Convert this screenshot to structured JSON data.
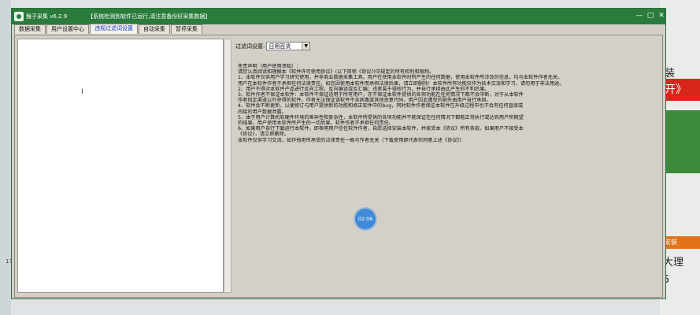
{
  "background": {
    "left_number": "17",
    "ad_text_1": "装",
    "ad_red": "开》",
    "ad_orange": "安装",
    "ad_text_2": "大理",
    "ad_text_3": "5"
  },
  "window": {
    "title": "猴子采集 v6.2.9",
    "notice": "【系统检测到软件已运行,请注意备份好采集数据】",
    "controls": {
      "minimize": "—",
      "maximize": "□",
      "close": "✕"
    }
  },
  "tabs": [
    {
      "label": "数据采集",
      "active": false
    },
    {
      "label": "用户设置中心",
      "active": false
    },
    {
      "label": "违规过滤词设置",
      "active": true
    },
    {
      "label": "自动采集",
      "active": false
    },
    {
      "label": "暂停采集",
      "active": false
    }
  ],
  "filter": {
    "label": "过滤词设置:",
    "selected": "日用百货"
  },
  "disclaimer": [
    "免责声明（用户使用须知）:",
    "请您认真阅读和理解本《软件许可使用协议》(以下简称《协议》)中规定的所有权利和限制。",
    "1、本软件仅供用户学习研究使用，并非商业数据采集工具。用户在使用本软件时所产生的任何数据，使用本软件所涉及的信息，均与本软件作者无关。",
    "用户在本软件作者不承担任何法律责任，如您因使用本软件而承担法律后果，请立即删除！本软件所有功能仅作为技术交流和学习，请勿用于非法用途。",
    "2、用户不得对本软件产品进行反向工程，反向编译或反汇编；违者属于侵权行为，并自行承担由此产生的不利后果。",
    "3、软件作者不保证本软件：本软件不保证适用于所有用户，亦不保证本软件提供的各项功能在任何情况下都不会中断，对于从本软件",
    "作者指定渠道以外获得的软件，作者无法保证该软件不含病毒或其他恶意代码，用户因此遭受的损失由用户自行承担。",
    "4、软件会不断更新，以便修订与用户提供新的功能和修正软件中的bug，同时软件作者保证本软件在升级过程中也不会有任何直接或",
    "间接的用户数据泄露。",
    "5、由于用户计算机软硬件环境的差异性和复杂性，本软件所提供的各项功能并不能保证在任何情况下都能正常执行或达到用户所期望",
    "的结果。用户使用本软件所产生的一切后果，软件作者不承担任何责任。",
    "6、如果用户自行下载运行本软件，即表明用户信任软件作者，自愿选择安装本软件，并接受本《协议》所有条款。如果用户不接受本",
    "《协议》，请立即删除。",
    "本软件仅供学习交流，如作他用所承受的法律责任一概与作者无关（下载使用即代表你同意上述《协议》）"
  ],
  "timer": "02:06",
  "colors": {
    "titlebar": "#2a7b3c",
    "active_tab_text": "#1a3dc0",
    "timer_badge": "#3f8ad9"
  }
}
